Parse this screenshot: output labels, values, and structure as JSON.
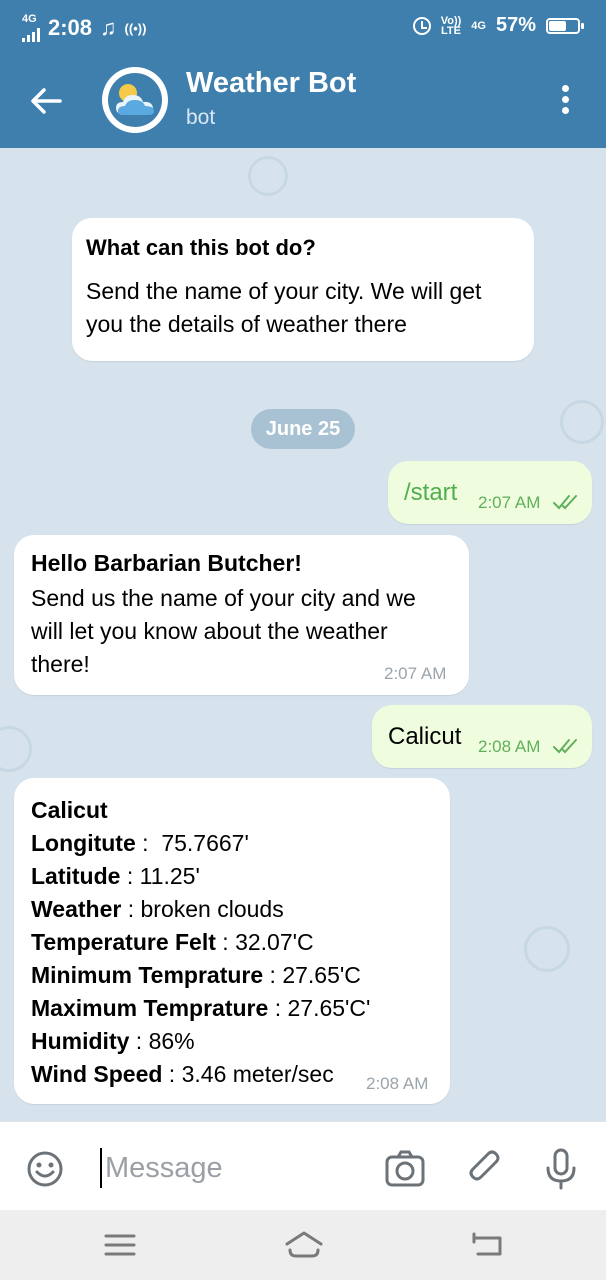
{
  "status": {
    "network": "4G",
    "time": "2:08",
    "volte": "Vo))",
    "lte": "LTE",
    "network2": "4G",
    "battery": "57%",
    "battery_level": 0.57
  },
  "header": {
    "title": "Weather Bot",
    "subtitle": "bot"
  },
  "intro": {
    "heading": "What can this bot do?",
    "line1": "Send the name of your city. We will get",
    "line2": "you the details of weather there"
  },
  "date_chip": "June 25",
  "messages": {
    "start": {
      "text": "/start",
      "time": "2:07 AM"
    },
    "hello": {
      "line1": "Hello Barbarian Butcher!",
      "line2": "Send us the name of your city and we",
      "line3": "will let you know about the weather",
      "line4": "there!",
      "time": "2:07 AM"
    },
    "calicut": {
      "text": "Calicut",
      "time": "2:08 AM"
    },
    "weather": {
      "city": "Calicut",
      "rows": [
        {
          "label": "Longitute",
          "sep": " :  ",
          "value": "75.7667'"
        },
        {
          "label": "Latitude",
          "sep": " : ",
          "value": "11.25'"
        },
        {
          "label": "Weather",
          "sep": " : ",
          "value": "broken clouds"
        },
        {
          "label": "Temperature Felt",
          "sep": " : ",
          "value": "32.07'C"
        },
        {
          "label": "Minimum Temprature",
          "sep": " : ",
          "value": "27.65'C"
        },
        {
          "label": "Maximum Temprature",
          "sep": " : ",
          "value": "27.65'C'"
        },
        {
          "label": "Humidity",
          "sep": " : ",
          "value": "86%"
        },
        {
          "label": "Wind Speed",
          "sep": " : ",
          "value": "3.46 meter/sec"
        }
      ],
      "time": "2:08 AM"
    }
  },
  "input": {
    "placeholder": "Message"
  },
  "colors": {
    "header": "#3f7fad",
    "chat_background": "#d6e3ec",
    "outgoing_bubble": "#effdde",
    "outgoing_time": "#5fb05c",
    "date_chip": "#a9c2d3"
  },
  "icons": [
    "back-arrow-icon",
    "weather-cloud-icon",
    "more-vert-icon",
    "emoji-icon",
    "camera-icon",
    "attach-icon",
    "mic-icon",
    "double-check-icon",
    "recents-nav-icon",
    "home-nav-icon",
    "back-nav-icon"
  ]
}
